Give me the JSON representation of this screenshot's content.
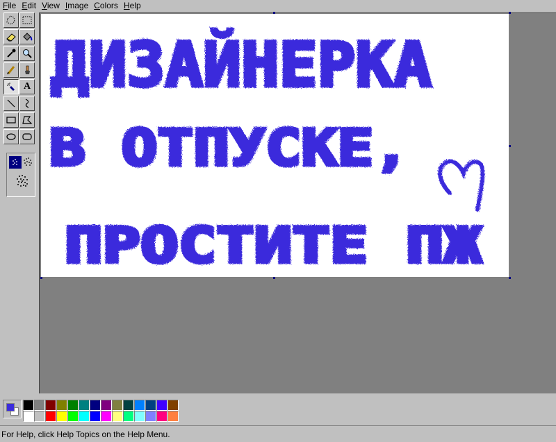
{
  "menu": [
    {
      "mnemonic": "F",
      "rest": "ile"
    },
    {
      "mnemonic": "E",
      "rest": "dit"
    },
    {
      "mnemonic": "V",
      "rest": "iew"
    },
    {
      "mnemonic": "I",
      "rest": "mage"
    },
    {
      "mnemonic": "C",
      "rest": "olors"
    },
    {
      "mnemonic": "H",
      "rest": "elp"
    }
  ],
  "tools": [
    {
      "name": "free-select-icon"
    },
    {
      "name": "rect-select-icon"
    },
    {
      "name": "eraser-icon"
    },
    {
      "name": "fill-bucket-icon"
    },
    {
      "name": "color-picker-icon"
    },
    {
      "name": "magnifier-icon"
    },
    {
      "name": "pencil-icon"
    },
    {
      "name": "brush-icon"
    },
    {
      "name": "airbrush-icon",
      "active": true
    },
    {
      "name": "text-icon",
      "label": "A"
    },
    {
      "name": "line-icon"
    },
    {
      "name": "curve-icon"
    },
    {
      "name": "rectangle-icon"
    },
    {
      "name": "polygon-icon"
    },
    {
      "name": "ellipse-icon"
    },
    {
      "name": "rounded-rect-icon"
    }
  ],
  "drawing": {
    "line1": "ДИЗАЙНЕРКА",
    "line2": "В ОТПУСКЕ,",
    "line3": "ПРОСТИТЕ ПЖ",
    "ink_color": "#3b2cdc"
  },
  "colors": {
    "foreground": "#3b2cdc",
    "background": "#ffffff",
    "palette_top": [
      "#000000",
      "#808080",
      "#800000",
      "#808000",
      "#008000",
      "#008080",
      "#000080",
      "#800080",
      "#808040",
      "#004040",
      "#0080ff",
      "#004080",
      "#4000ff",
      "#804000"
    ],
    "palette_bottom": [
      "#ffffff",
      "#c0c0c0",
      "#ff0000",
      "#ffff00",
      "#00ff00",
      "#00ffff",
      "#0000ff",
      "#ff00ff",
      "#ffff80",
      "#00ff80",
      "#80ffff",
      "#8080ff",
      "#ff0080",
      "#ff8040"
    ]
  },
  "status": {
    "text": "For Help, click Help Topics on the Help Menu."
  }
}
